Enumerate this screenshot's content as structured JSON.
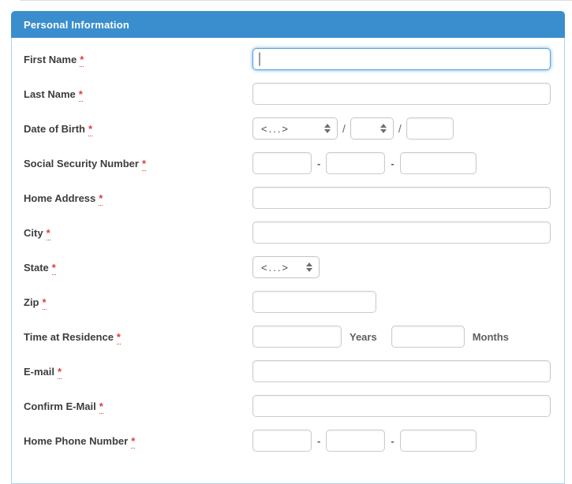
{
  "page": {
    "required_marker": "*"
  },
  "panel": {
    "title": "Personal Information"
  },
  "labels": {
    "first_name": "First Name",
    "last_name": "Last Name",
    "dob": "Date of Birth",
    "ssn": "Social Security Number",
    "home_address": "Home Address",
    "city": "City",
    "state": "State",
    "zip": "Zip",
    "time_at_residence": "Time at Residence",
    "email": "E-mail",
    "confirm_email": "Confirm E-Mail",
    "home_phone": "Home Phone Number"
  },
  "fields": {
    "first_name": {
      "value": "",
      "focused": true
    },
    "last_name": {
      "value": ""
    },
    "dob": {
      "month_value": "<...>",
      "day_value": "",
      "year_value": "",
      "separator": "/"
    },
    "ssn": {
      "part1": "",
      "part2": "",
      "part3": "",
      "separator": "-"
    },
    "home_address": {
      "value": ""
    },
    "city": {
      "value": ""
    },
    "state": {
      "value": "<...>"
    },
    "zip": {
      "value": ""
    },
    "time_at_residence": {
      "years_value": "",
      "months_value": "",
      "years_label": "Years",
      "months_label": "Months"
    },
    "email": {
      "value": ""
    },
    "confirm_email": {
      "value": ""
    },
    "home_phone": {
      "part1": "",
      "part2": "",
      "part3": "",
      "separator": "-"
    }
  },
  "colors": {
    "header_bg": "#3a8ecd",
    "header_text": "#ffffff",
    "panel_border": "#aed2ec",
    "label_text": "#3d3d3d",
    "required_red": "#e23b3b",
    "input_border": "#cbcbcb",
    "focus_blue": "#5ca5e0",
    "select_arrow_gray": "#6e6e6e"
  }
}
